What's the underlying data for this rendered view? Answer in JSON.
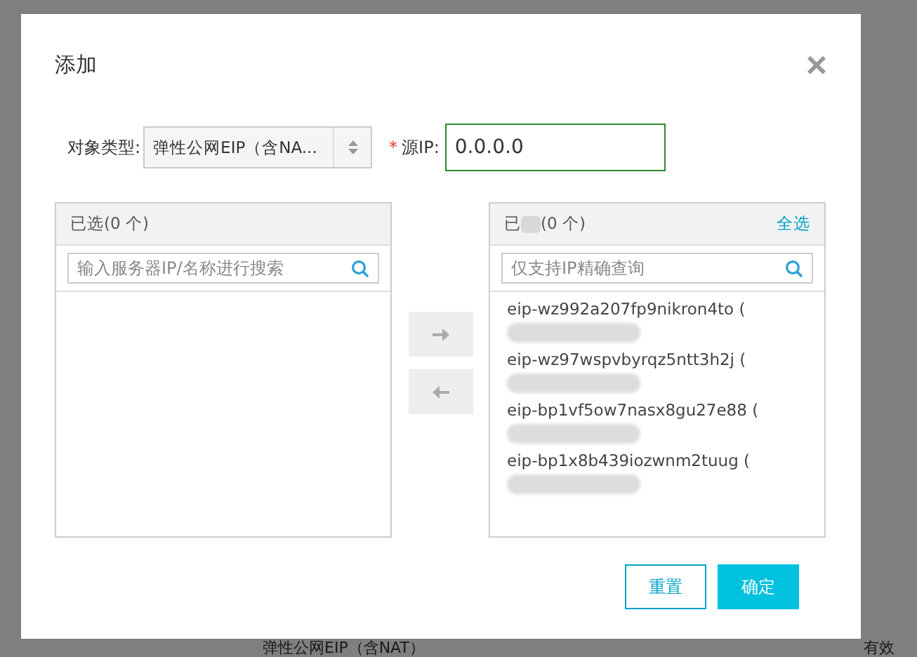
{
  "background": {
    "row_type": "弹性公网EIP（含NAT）",
    "row_status": "有效"
  },
  "dialog": {
    "title": "添加",
    "close": "×",
    "object_type": {
      "label": "对象类型:",
      "value": "弹性公网EIP（含NA..."
    },
    "source_ip": {
      "required_mark": "*",
      "label": "源IP:",
      "value": "0.0.0.0"
    },
    "left_panel": {
      "title": "已选(0 个)",
      "search_placeholder": "输入服务器IP/名称进行搜索"
    },
    "right_panel": {
      "title_start": "已",
      "title_end": "(0 个)",
      "select_all": "全选",
      "search_placeholder": "仅支持IP精确查询",
      "items": [
        {
          "name": "eip-wz992a207fp9nikron4to ("
        },
        {
          "name": "eip-wz97wspvbyrqz5ntt3h2j ("
        },
        {
          "name": "eip-bp1vf5ow7nasx8gu27e88 ("
        },
        {
          "name": "eip-bp1x8b439iozwnm2tuug ("
        }
      ]
    },
    "buttons": [
      {
        "label": "重置",
        "kind": "secondary"
      },
      {
        "label": "确定",
        "kind": "primary"
      }
    ]
  }
}
